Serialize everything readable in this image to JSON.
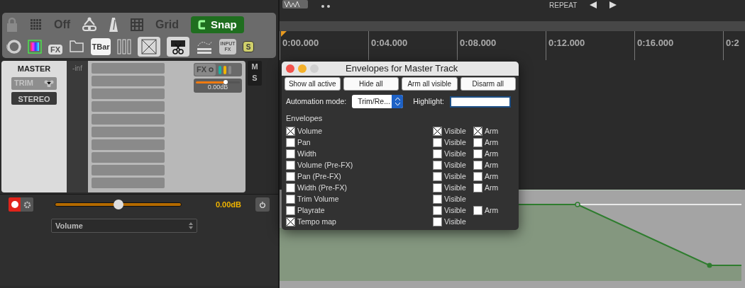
{
  "toolbar": {
    "row1": [
      {
        "kind": "lock",
        "on": false
      },
      {
        "kind": "grid-dots",
        "on": false
      },
      {
        "kind": "label",
        "label": "Off"
      },
      {
        "kind": "link",
        "on": false
      },
      {
        "kind": "metronome",
        "on": false
      },
      {
        "kind": "grid-lines",
        "on": false
      },
      {
        "kind": "label",
        "label": "Grid"
      },
      {
        "kind": "snap",
        "label": "Snap",
        "on": true
      }
    ],
    "row2": [
      {
        "kind": "ring",
        "on": false
      },
      {
        "kind": "colors",
        "on": false
      },
      {
        "kind": "fx",
        "label": "FX",
        "on": false
      },
      {
        "kind": "folder",
        "on": false
      },
      {
        "kind": "text",
        "label": "TBar",
        "on": true
      },
      {
        "kind": "mixer",
        "on": false
      },
      {
        "kind": "cross",
        "on": true
      },
      {
        "kind": "scissors",
        "on": true
      },
      {
        "kind": "ripple",
        "on": false
      },
      {
        "kind": "input-fx",
        "label": "INPUT FX",
        "on": false
      },
      {
        "kind": "solo",
        "label": "S",
        "on": false
      }
    ]
  },
  "track": {
    "name": "MASTER",
    "trim": "TRIM",
    "channel": "STEREO",
    "meter_reading": "-inf",
    "fx": "FX",
    "fx_bypassed": false,
    "volume_slider": {
      "level": 0.68
    },
    "volume": "0.00dB",
    "mute": "M",
    "solo": "S"
  },
  "envelope_lane": {
    "armed": true,
    "level": 0.5,
    "value": "0.00dB",
    "parameter": "Volume"
  },
  "top_toolbar": {
    "repeat": "REPEAT"
  },
  "ruler": {
    "labels": [
      "0:00.000",
      "0:04.000",
      "0:08.000",
      "0:12.000",
      "0:16.000",
      "0:2"
    ]
  },
  "dialog": {
    "title": "Envelopes for Master Track",
    "buttons": [
      "Show all active",
      "Hide all",
      "Arm all visible",
      "Disarm all"
    ],
    "automation_label": "Automation mode:",
    "automation_mode": "Trim/Re...",
    "highlight_label": "Highlight:",
    "envelopes_label": "Envelopes",
    "envelopes": [
      {
        "name": "Volume",
        "checked": true,
        "visible_label": "Visible",
        "visible": true,
        "arm_label": "Arm",
        "arm": true
      },
      {
        "name": "Pan",
        "checked": false,
        "visible_label": "Visible",
        "visible": false,
        "arm_label": "Arm",
        "arm": false
      },
      {
        "name": "Width",
        "checked": false,
        "visible_label": "Visible",
        "visible": false,
        "arm_label": "Arm",
        "arm": false
      },
      {
        "name": "Volume (Pre-FX)",
        "checked": false,
        "visible_label": "Visible",
        "visible": false,
        "arm_label": "Arm",
        "arm": false
      },
      {
        "name": "Pan (Pre-FX)",
        "checked": false,
        "visible_label": "Visible",
        "visible": false,
        "arm_label": "Arm",
        "arm": false
      },
      {
        "name": "Width (Pre-FX)",
        "checked": false,
        "visible_label": "Visible",
        "visible": false,
        "arm_label": "Arm",
        "arm": false
      },
      {
        "name": "Trim Volume",
        "checked": false,
        "visible_label": "Visible",
        "visible": false
      },
      {
        "name": "Playrate",
        "checked": false,
        "visible_label": "Visible",
        "visible": false,
        "arm_label": "Arm",
        "arm": false
      },
      {
        "name": "Tempo map",
        "checked": true,
        "visible_label": "Visible",
        "visible": false
      }
    ]
  }
}
